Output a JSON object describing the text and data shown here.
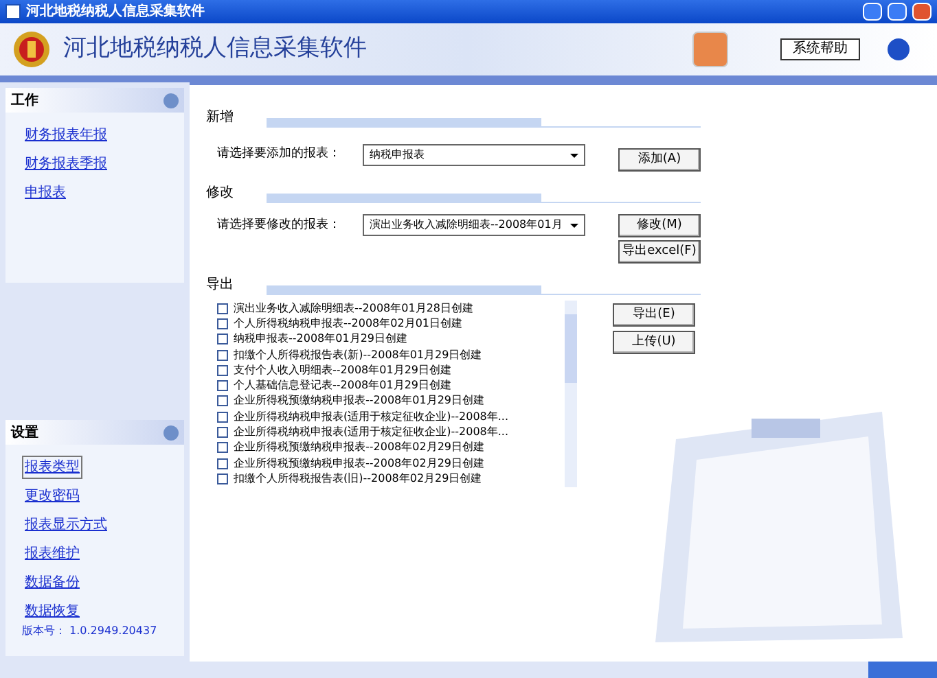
{
  "window": {
    "title": "河北地税纳税人信息采集软件"
  },
  "header": {
    "app_name": "河北地税纳税人信息采集软件",
    "help_button": "系统帮助"
  },
  "sidebar": {
    "sections": [
      {
        "title": "工作",
        "items": [
          {
            "label": "财务报表年报",
            "selected": false
          },
          {
            "label": "财务报表季报",
            "selected": false
          },
          {
            "label": "申报表",
            "selected": false
          }
        ]
      },
      {
        "title": "设置",
        "items": [
          {
            "label": "报表类型",
            "selected": true
          },
          {
            "label": "更改密码",
            "selected": false
          },
          {
            "label": "报表显示方式",
            "selected": false
          },
          {
            "label": "报表维护",
            "selected": false
          },
          {
            "label": "数据备份",
            "selected": false
          },
          {
            "label": "数据恢复",
            "selected": false
          }
        ],
        "version": "版本号： 1.0.2949.20437"
      }
    ]
  },
  "add": {
    "title": "新增",
    "label": "请选择要添加的报表：",
    "value": "纳税申报表",
    "button": "添加(A)"
  },
  "modify": {
    "title": "修改",
    "label": "请选择要修改的报表：",
    "value": "演出业务收入减除明细表--2008年01月",
    "buttons": [
      "修改(M)",
      "导出excel(F)"
    ]
  },
  "export": {
    "title": "导出",
    "buttons": [
      "导出(E)",
      "上传(U)"
    ],
    "items": [
      {
        "label": "演出业务收入减除明细表--2008年01月28日创建",
        "checked": false
      },
      {
        "label": "个人所得税纳税申报表--2008年02月01日创建",
        "checked": false
      },
      {
        "label": "纳税申报表--2008年01月29日创建",
        "checked": false
      },
      {
        "label": "扣缴个人所得税报告表(新)--2008年01月29日创建",
        "checked": false
      },
      {
        "label": "支付个人收入明细表--2008年01月29日创建",
        "checked": false
      },
      {
        "label": "个人基础信息登记表--2008年01月29日创建",
        "checked": false
      },
      {
        "label": "企业所得税预缴纳税申报表--2008年01月29日创建",
        "checked": false
      },
      {
        "label": "企业所得税纳税申报表(适用于核定征收企业)--2008年...",
        "checked": false
      },
      {
        "label": "企业所得税纳税申报表(适用于核定征收企业)--2008年...",
        "checked": false
      },
      {
        "label": "企业所得税预缴纳税申报表--2008年02月29日创建",
        "checked": false
      },
      {
        "label": "企业所得税预缴纳税申报表--2008年02月29日创建",
        "checked": false
      },
      {
        "label": "扣缴个人所得税报告表(旧)--2008年02月29日创建",
        "checked": false
      }
    ]
  }
}
